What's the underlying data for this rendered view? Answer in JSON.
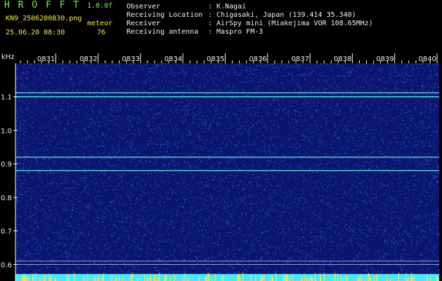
{
  "header": {
    "app_name": "H R O F F T",
    "version": "1.0.0f",
    "filename": "KN9_2506200830.png",
    "datetime": "25.06.20 08:30",
    "meteor_label": "meteor",
    "meteor_count": "76"
  },
  "info": [
    {
      "label": "Observer",
      "value": ": K.Nagai"
    },
    {
      "label": "Receiving Location",
      "value": ": Chigasaki, Japan (139.414 35.340)"
    },
    {
      "label": "Receiver",
      "value": ": AirSpy mini (Miakejima VOR 108.65MHz)"
    },
    {
      "label": "Receiving antenna",
      "value": ": Maspro FM-3"
    }
  ],
  "chart_data": {
    "type": "heatmap",
    "ylabel": "kHz",
    "x_ticks": [
      "0831",
      "0832",
      "0833",
      "0834",
      "0835",
      "0836",
      "0837",
      "0838",
      "0839",
      "0840"
    ],
    "y_ticks": [
      1.1,
      1.0,
      0.9,
      0.8,
      0.7,
      0.6
    ],
    "ylim": [
      0.58,
      1.2
    ],
    "horizontal_lines_khz": [
      1.112,
      1.1,
      0.92,
      0.88,
      0.61,
      0.6
    ],
    "colors": {
      "background": "#0b1670",
      "noise": "#3a6cf0",
      "signal": "#5cf0e0",
      "bottom_band": "#48e8f8",
      "marks": "#f4ec4a"
    }
  }
}
